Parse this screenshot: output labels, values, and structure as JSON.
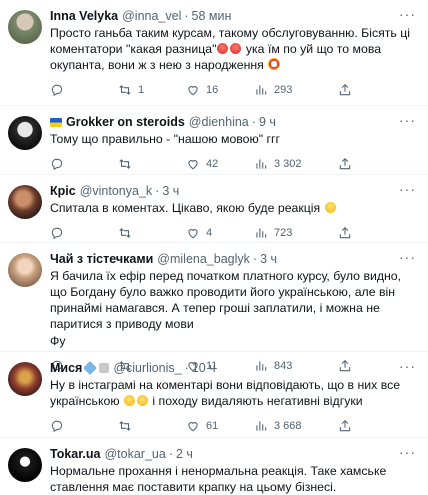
{
  "tweets": [
    {
      "name": "Inna Velyka",
      "handle": "@inna_vel",
      "time": "58 мин",
      "text_1": "Просто ганьба таким курсам, такому обслуговуванню. Бісять ці коментатори \"какая разница\"",
      "text_2": " ука їм по  уй що то мова окупанта, вони ж з нею з народження ",
      "replies": "",
      "retweets": "1",
      "likes": "16",
      "views": "293"
    },
    {
      "name": "Grokker on steroids",
      "handle": "@dienhina",
      "time": "9 ч",
      "text": "Тому що правильно - \"нашою мовою\" ггг",
      "replies": "",
      "retweets": "",
      "likes": "42",
      "views": "3 302"
    },
    {
      "name": "Кріс",
      "handle": "@vintonya_k",
      "time": "3 ч",
      "text": "Спитала в коментах. Цікаво, якою буде реакція",
      "replies": "",
      "retweets": "",
      "likes": "4",
      "views": "723"
    },
    {
      "name": "Чай з тістечками",
      "handle": "@milena_baglyk",
      "time": "3 ч",
      "text": "Я бачила їх ефір перед початком платного курсу, було видно, що Богдану було важко проводити його українською, але він принаймі намагався. А тепер гроші заплатили, і можна не паритися з приводу мови",
      "text_2": "Фу",
      "replies": "",
      "retweets": "",
      "likes": "11",
      "views": "843"
    },
    {
      "name": "Мися",
      "handle": "@ciurlionis_",
      "time": "10 ч",
      "text": "Ну в інстаграмі на коментарі вони відповідають, що в них все українською",
      "text_2": " і походу видаляють негативні відгуки",
      "replies": "",
      "retweets": "",
      "likes": "61",
      "views": "3 668"
    },
    {
      "name": "Tokar.ua",
      "handle": "@tokar_ua",
      "time": "2 ч",
      "text": "Нормальне прохання і ненормальна реакція. Таке хамське ставлення має поставити крапку на цьому бізнесі."
    }
  ],
  "icons": {
    "reply": "reply-icon",
    "retweet": "retweet-icon",
    "like": "heart-icon",
    "views": "views-icon",
    "share": "share-icon",
    "more": "more-icon"
  },
  "dot": "·",
  "more_glyph": "···",
  "colors": {
    "muted": "#536471",
    "text": "#0f1419",
    "divider": "#eff3f4"
  }
}
